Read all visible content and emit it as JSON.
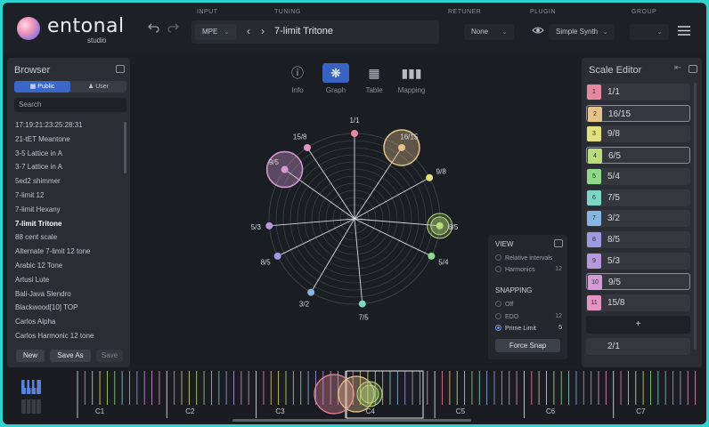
{
  "header": {
    "brand": "entonal",
    "brand_sub": "studio",
    "labels": {
      "input": "INPUT",
      "tuning": "TUNING",
      "retuner": "RETUNER",
      "plugin": "PLUGIN",
      "group": "GROUP"
    },
    "input_value": "MPE",
    "tuning_title": "7-limit Tritone",
    "retuner_value": "None",
    "plugin_value": "Simple Synth",
    "group_value": ""
  },
  "browser": {
    "title": "Browser",
    "tab_public": "Public",
    "tab_user": "User",
    "search_placeholder": "Search",
    "items": [
      "17:19:21:23:25:28:31",
      "21-tET Meantone",
      "3-5 Lattice in A",
      "3-7 Lattice in A",
      "5ed2 shimmer",
      "7-limit 12",
      "7-limit Hexany",
      "7-limit Tritone",
      "88 cent scale",
      "Alternate 7-limit 12 tone",
      "Arabic 12 Tone",
      "Artusi Lute",
      "Bali-Java Slendro",
      "Blackwood[10] TOP",
      "Carlos Alpha",
      "Carlos Harmonic 12 tone"
    ],
    "active_index": 7,
    "btn_new": "New",
    "btn_save_as": "Save As",
    "btn_save": "Save"
  },
  "view_tabs": [
    {
      "label": "Info",
      "icon": "info-icon"
    },
    {
      "label": "Graph",
      "icon": "graph-icon"
    },
    {
      "label": "Table",
      "icon": "table-icon"
    },
    {
      "label": "Mapping",
      "icon": "mapping-icon"
    }
  ],
  "active_view": 1,
  "view_panel": {
    "title": "VIEW",
    "relative_intervals": "Relative intervals",
    "harmonics": "Harmonics",
    "harmonics_value": "12",
    "snapping_title": "SNAPPING",
    "off": "Off",
    "edo": "EDO",
    "edo_value": "12",
    "prime_limit": "Prime Limit",
    "prime_limit_value": "5",
    "force_snap": "Force Snap"
  },
  "scale_editor": {
    "title": "Scale Editor",
    "rows": [
      {
        "num": "1",
        "value": "1/1",
        "color": "#e8879e",
        "selected": false
      },
      {
        "num": "2",
        "value": "16/15",
        "color": "#e4c48c",
        "selected": true
      },
      {
        "num": "3",
        "value": "9/8",
        "color": "#e2e07f",
        "selected": false
      },
      {
        "num": "4",
        "value": "6/5",
        "color": "#b8dd7a",
        "selected": true
      },
      {
        "num": "5",
        "value": "5/4",
        "color": "#8fd98a",
        "selected": false
      },
      {
        "num": "6",
        "value": "7/5",
        "color": "#7fd6c4",
        "selected": false
      },
      {
        "num": "7",
        "value": "3/2",
        "color": "#86b6e3",
        "selected": false
      },
      {
        "num": "8",
        "value": "8/5",
        "color": "#9d9be0",
        "selected": false
      },
      {
        "num": "9",
        "value": "5/3",
        "color": "#b798de",
        "selected": false
      },
      {
        "num": "10",
        "value": "9/5",
        "color": "#d69bd6",
        "selected": true
      },
      {
        "num": "11",
        "value": "15/8",
        "color": "#e295c2",
        "selected": false
      }
    ],
    "add_label": "+",
    "period": "2/1"
  },
  "graph_nodes": [
    {
      "label": "1/1",
      "cents": 0,
      "color": "#e8879e",
      "halo": 0
    },
    {
      "label": "16/15",
      "cents": 111.7,
      "color": "#e4c48c",
      "halo": 1
    },
    {
      "label": "9/8",
      "cents": 203.9,
      "color": "#e2e07f",
      "halo": 0
    },
    {
      "label": "6/5",
      "cents": 315.6,
      "color": "#b8dd7a",
      "halo": 2
    },
    {
      "label": "5/4",
      "cents": 386.3,
      "color": "#8fd98a",
      "halo": 0
    },
    {
      "label": "7/5",
      "cents": 582.5,
      "color": "#7fd6c4",
      "halo": 0
    },
    {
      "label": "3/2",
      "cents": 702.0,
      "color": "#86b6e3",
      "halo": 0
    },
    {
      "label": "8/5",
      "cents": 813.7,
      "color": "#9d9be0",
      "halo": 0
    },
    {
      "label": "5/3",
      "cents": 884.4,
      "color": "#b798de",
      "halo": 0
    },
    {
      "label": "9/5",
      "cents": 1017.6,
      "color": "#d69bd6",
      "halo": 1
    },
    {
      "label": "15/8",
      "cents": 1088.3,
      "color": "#e295c2",
      "halo": 0
    }
  ],
  "keyboard": {
    "octaves": [
      "C1",
      "C2",
      "C3",
      "C4",
      "C5",
      "C6",
      "C7"
    ]
  }
}
